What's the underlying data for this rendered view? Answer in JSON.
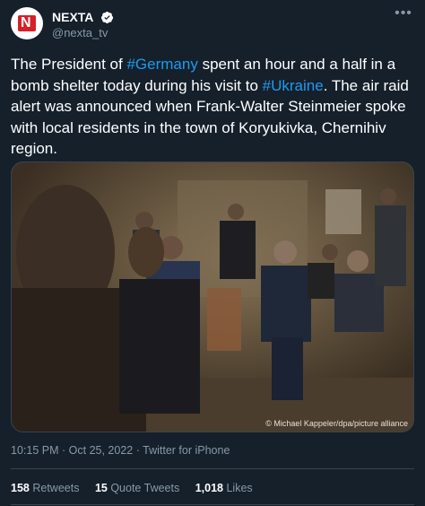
{
  "author": {
    "display_name": "NEXTA",
    "handle": "@nexta_tv",
    "avatar_letter": "N"
  },
  "tweet": {
    "text_parts": [
      {
        "text": "The President of ",
        "type": "text"
      },
      {
        "text": "#Germany",
        "type": "hashtag"
      },
      {
        "text": " spent an hour and a half in a bomb shelter today during his visit to ",
        "type": "text"
      },
      {
        "text": "#Ukraine",
        "type": "hashtag"
      },
      {
        "text": ". The air raid alert was announced when Frank-Walter Steinmeier spoke with local residents in the town of Koryukivka, Chernihiv region.",
        "type": "text"
      }
    ]
  },
  "photo": {
    "credit": "© Michael Kappeler/dpa/picture alliance"
  },
  "meta": {
    "time": "10:15 PM",
    "date": "Oct 25, 2022",
    "source": "Twitter for iPhone",
    "separator": "·"
  },
  "stats": {
    "retweets_count": "158",
    "retweets_label": "Retweets",
    "quotes_count": "15",
    "quotes_label": "Quote Tweets",
    "likes_count": "1,018",
    "likes_label": "Likes"
  },
  "colors": {
    "background": "#15202b",
    "link": "#1d9bf0",
    "secondary_text": "#8899a6",
    "divider": "#38444d",
    "avatar_brand": "#d71f28"
  },
  "icons": {
    "more": "more-horizontal-icon",
    "verified": "verified-badge-icon"
  }
}
